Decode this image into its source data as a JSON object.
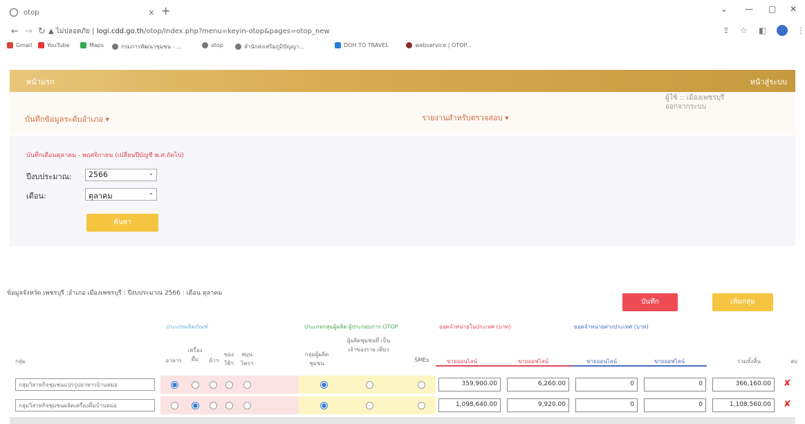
{
  "browser": {
    "tab_title": "otop",
    "url_warning": "ไม่ปลอดภัย",
    "url_host": "logi.cdd.go.th",
    "url_path": "/otop/index.php?menu=keyin-otop&pages=otop_new",
    "bookmarks": [
      {
        "label": "Gmail",
        "icon": "gmail-icon",
        "color": "#d44638"
      },
      {
        "label": "YouTube",
        "icon": "youtube-icon",
        "color": "#e53935"
      },
      {
        "label": "Maps",
        "icon": "maps-icon",
        "color": "#34a853"
      },
      {
        "label": "กรมการพัฒนาชุมชน - ...",
        "icon": "globe-icon",
        "color": "#777777"
      },
      {
        "label": "otop",
        "icon": "globe-icon",
        "color": "#777777"
      },
      {
        "label": "สำนักส่งเสริมภูมิปัญญา...",
        "icon": "globe-icon",
        "color": "#777777"
      },
      {
        "label": "DOH TO TRAVEL",
        "icon": "doh-icon",
        "color": "#2a7fd4"
      },
      {
        "label": "webservice | OTOP...",
        "icon": "webservice-icon",
        "color": "#8a2b2b"
      }
    ]
  },
  "header": {
    "home_label": "หน้าแรก",
    "login_label": "หน้าสู่ระบบ"
  },
  "menu": {
    "record_label": "บันทึกข้อมูลระดับอำเภอ ▾",
    "report_label": "รายงานสำหรับตรวจสอบ ▾",
    "user_label": "ผู้ใช้ :: เมืองเพชรบุรี",
    "logout_label": "ออกจากระบบ"
  },
  "filter": {
    "title": "บันทึกเดือนตุลาคม - พฤศจิกายน (เปลี่ยนปีบัญชี พ.ศ.ถัดไป)",
    "year_label": "ปีงบประมาณ:",
    "year_value": "2566",
    "month_label": "เดือน:",
    "month_value": "ตุลาคม",
    "search_label": "ค้นหา"
  },
  "info_line": "ข้อมูลจังหวัด เพชรบุรี :อำเภอ เมืองเพชรบุรี : ปีงบประมาณ 2566 : เดือน ตุลาคม",
  "actions": {
    "save_label": "บันทึก",
    "add_group_label": "เพิ่มกลุ่ม"
  },
  "table": {
    "group_headers": {
      "product_type": "ประเภทผลิตภัณฑ์",
      "producer_type": "ประเภทกลุ่มผู้ผลิต ผู้ประกอบการ OTOP",
      "domestic_sales": "ยอดจำหน่ายในประเทศ (บาท)",
      "export_sales": "ยอดจำหน่ายต่างประเทศ (บาท)"
    },
    "columns": {
      "group": "กลุ่ม",
      "food": "อาหาร",
      "drink": "เครื่อง ดื่ม",
      "cloth": "ผ้าฯ",
      "utensil": "ของ ใช้ฯ",
      "herb": "สมุน ไพรฯ",
      "community": "กลุ่มผู้ผลิต ชุมชน",
      "single": "ผู้ผลิตชุมชนที่ เป็นเจ้าของราย เดียว",
      "smes": "SMEs",
      "dom_online": "ขายออนไลน์",
      "dom_offline": "ขายออฟไลน์",
      "exp_online": "ขายออนไลน์",
      "exp_offline": "ขายออฟไลน์",
      "total": "รวมทั้งสิ้น",
      "del": "ลบ"
    },
    "rows": [
      {
        "group_name": "กลุ่มวิสาหกิจชุมชนแปรรูปอาหารบ้านหม่อ",
        "product_selected": "food",
        "producer_selected": "community",
        "dom_online": "359,900.00",
        "dom_offline": "6,260.00",
        "exp_online": "0",
        "exp_offline": "0",
        "total": "366,160.00"
      },
      {
        "group_name": "กลุ่มวิสาหกิจชุมชนผลิตเครื่องดื่มบ้านหม่อ",
        "product_selected": "drink",
        "producer_selected": "community",
        "dom_online": "1,098,640.00",
        "dom_offline": "9,920.00",
        "exp_online": "0",
        "exp_offline": "0",
        "total": "1,108,560.00"
      }
    ]
  },
  "colors": {
    "header_gold": "#d8ac52",
    "save_red": "#ef4b55",
    "button_yellow": "#f5c542",
    "product_band": "#fbe3e3",
    "producer_band": "#fdf6c4",
    "radio_blue": "#3a7bd5"
  }
}
